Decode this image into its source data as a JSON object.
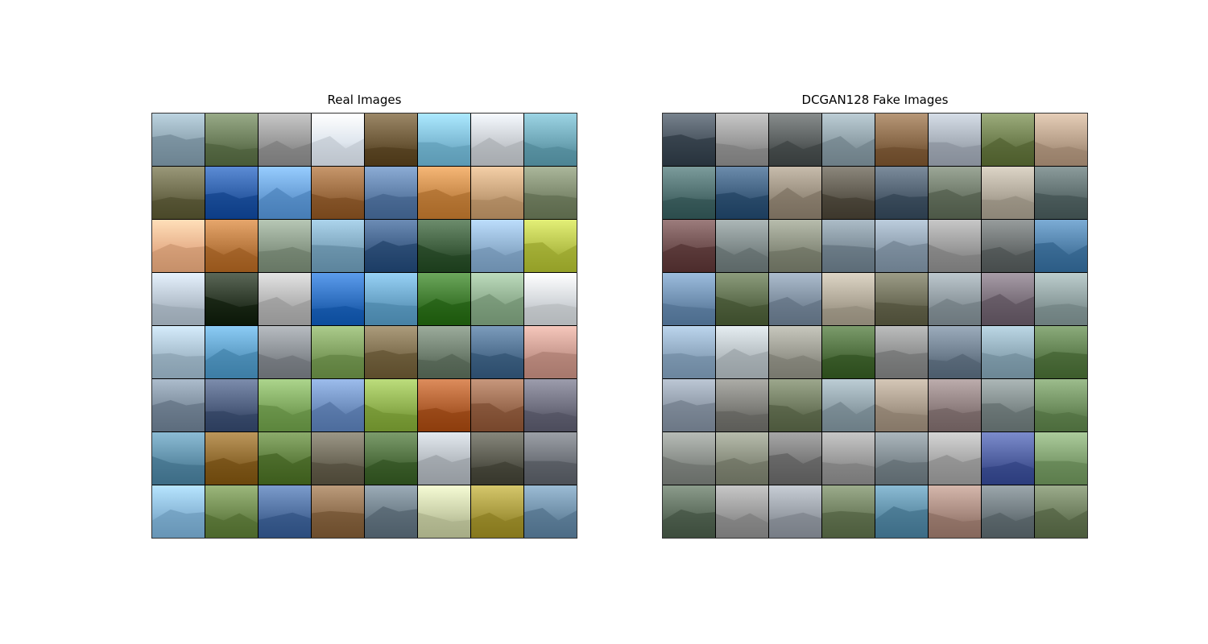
{
  "panels": {
    "real": {
      "title": "Real Images"
    },
    "fake": {
      "title": "DCGAN128 Fake Images"
    }
  },
  "palette": {
    "real": [
      [
        "#8fa6b3",
        "#6b7d5a",
        "#9a9a9a",
        "#dfe6ee",
        "#6e5a3a",
        "#7fbcd6",
        "#c9cdd2",
        "#6fa7b7"
      ],
      [
        "#6d6b4c",
        "#2f5fa8",
        "#6aa0d8",
        "#9a6a3f",
        "#5f7fa8",
        "#c98a4a",
        "#c7a27a",
        "#7e8a6e"
      ],
      [
        "#e8b28c",
        "#b9793f",
        "#8a9a88",
        "#7fa7bf",
        "#3f5f88",
        "#3f5f3f",
        "#8fb0cf",
        "#b6c24a"
      ],
      [
        "#b8c4d0",
        "#2e3a2a",
        "#b6b6b6",
        "#2f6fbf",
        "#6aa4c8",
        "#3f7a2f",
        "#8fae8f",
        "#d4d8dc"
      ],
      [
        "#a8bfcf",
        "#5f9fc8",
        "#8a8f94",
        "#7f9f5f",
        "#7f6f4f",
        "#6f7f6f",
        "#4f6f8f",
        "#c99a8f"
      ],
      [
        "#7f8f9f",
        "#4f5f7f",
        "#7fa85f",
        "#6f8fbf",
        "#8fb04f",
        "#b05f2f",
        "#9a6a4f",
        "#6f6f7f"
      ],
      [
        "#5f8fa8",
        "#8f6a2f",
        "#5f7f3f",
        "#6f6a5a",
        "#4f6f3f",
        "#b6bcc2",
        "#5a5a4f",
        "#6f737a"
      ],
      [
        "#8ab8d8",
        "#6f8a4f",
        "#4f6f9f",
        "#8f6f4f",
        "#6f7f8a",
        "#c9cfa8",
        "#a89a3f",
        "#6f8fa8"
      ]
    ],
    "fake": [
      [
        "#4a5560",
        "#9a9a9a",
        "#5a5f5f",
        "#8fa0a8",
        "#8a6a4a",
        "#a8b0ba",
        "#6f7f4f",
        "#b8a08a"
      ],
      [
        "#4f6f6f",
        "#3f5f7f",
        "#9a8f7f",
        "#5f5a4f",
        "#4f5f6f",
        "#6f7a6a",
        "#b0a89a",
        "#5f6f6f"
      ],
      [
        "#6f4f4f",
        "#7f8a8a",
        "#8a8f7f",
        "#7f8f9a",
        "#8fa0b0",
        "#9a9a9a",
        "#6a6f6f",
        "#4f7fa8"
      ],
      [
        "#6f8fb0",
        "#5f6f4f",
        "#7f8fa0",
        "#b0a898",
        "#6f6f5a",
        "#8f9aa0",
        "#7a6f7a",
        "#8fa0a0"
      ],
      [
        "#8fa8c0",
        "#b8c0c4",
        "#9a9a90",
        "#4f6f3f",
        "#8f9090",
        "#6f7f8f",
        "#8faab8",
        "#5f7f4f"
      ],
      [
        "#8f9aa8",
        "#7f7f7a",
        "#6f7a5f",
        "#8fa0a8",
        "#a89a8a",
        "#8f7f7f",
        "#7f8a8a",
        "#6f8f5f"
      ],
      [
        "#8a8f8a",
        "#8a8f7f",
        "#7a7a7a",
        "#9a9a9a",
        "#7f8a90",
        "#a8a8a8",
        "#4f5f9f",
        "#7f9f6f"
      ],
      [
        "#5f6f5f",
        "#9a9a9a",
        "#9aa0a8",
        "#6f7f5f",
        "#5f8fa8",
        "#a88a7f",
        "#6f7a7f",
        "#6f7f5f"
      ]
    ]
  }
}
